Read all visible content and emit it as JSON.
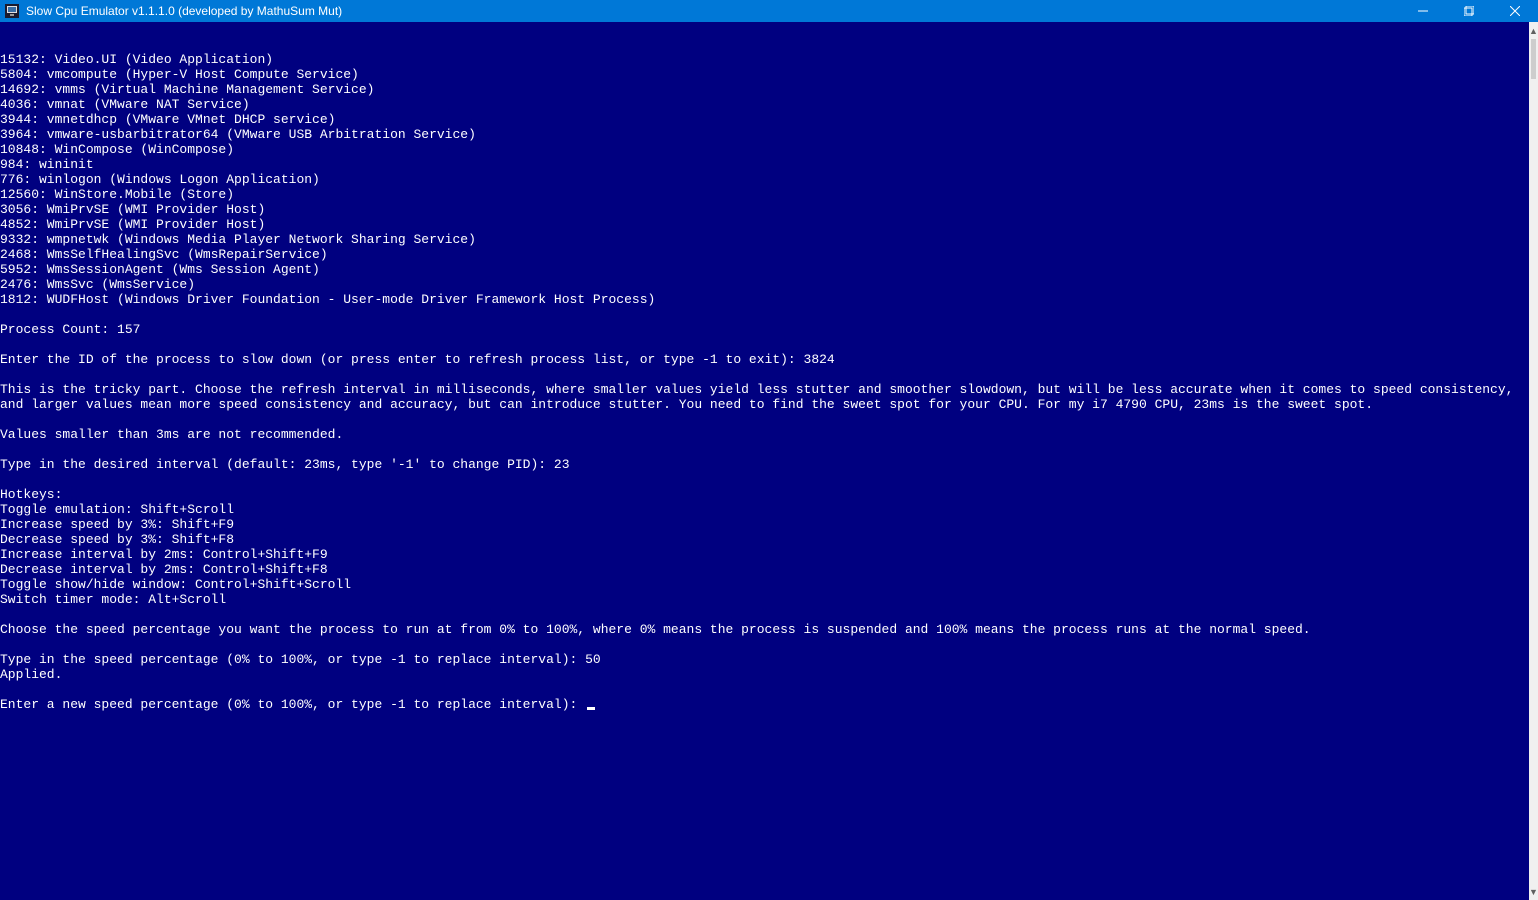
{
  "window": {
    "title": "Slow Cpu Emulator v1.1.1.0 (developed by MathuSum Mut)"
  },
  "console": {
    "processes": [
      "15132: Video.UI (Video Application)",
      "5804: vmcompute (Hyper-V Host Compute Service)",
      "14692: vmms (Virtual Machine Management Service)",
      "4036: vmnat (VMware NAT Service)",
      "3944: vmnetdhcp (VMware VMnet DHCP service)",
      "3964: vmware-usbarbitrator64 (VMware USB Arbitration Service)",
      "10848: WinCompose (WinCompose)",
      "984: wininit",
      "776: winlogon (Windows Logon Application)",
      "12560: WinStore.Mobile (Store)",
      "3056: WmiPrvSE (WMI Provider Host)",
      "4852: WmiPrvSE (WMI Provider Host)",
      "9332: wmpnetwk (Windows Media Player Network Sharing Service)",
      "2468: WmsSelfHealingSvc (WmsRepairService)",
      "5952: WmsSessionAgent (Wms Session Agent)",
      "2476: WmsSvc (WmsService)",
      "1812: WUDFHost (Windows Driver Foundation - User-mode Driver Framework Host Process)"
    ],
    "process_count_line": "Process Count: 157",
    "prompt_pid": "Enter the ID of the process to slow down (or press enter to refresh process list, or type -1 to exit): 3824",
    "tricky1": "This is the tricky part. Choose the refresh interval in milliseconds, where smaller values yield less stutter and smoother slowdown, but will be less accurate when it comes to speed consistency, and larger values mean more speed consistency and accuracy, but can introduce stutter. You need to find the sweet spot for your CPU. For my i7 4790 CPU, 23ms is the sweet spot.",
    "tricky2": "Values smaller than 3ms are not recommended.",
    "prompt_interval": "Type in the desired interval (default: 23ms, type '-1' to change PID): 23",
    "hotkeys_header": "Hotkeys:",
    "hotkeys": [
      "Toggle emulation: Shift+Scroll",
      "Increase speed by 3%: Shift+F9",
      "Decrease speed by 3%: Shift+F8",
      "Increase interval by 2ms: Control+Shift+F9",
      "Decrease interval by 2ms: Control+Shift+F8",
      "Toggle show/hide window: Control+Shift+Scroll",
      "Switch timer mode: Alt+Scroll"
    ],
    "speed_explain": "Choose the speed percentage you want the process to run at from 0% to 100%, where 0% means the process is suspended and 100% means the process runs at the normal speed.",
    "prompt_speed": "Type in the speed percentage (0% to 100%, or type -1 to replace interval): 50",
    "applied": "Applied.",
    "prompt_new_speed": "Enter a new speed percentage (0% to 100%, or type -1 to replace interval): "
  }
}
